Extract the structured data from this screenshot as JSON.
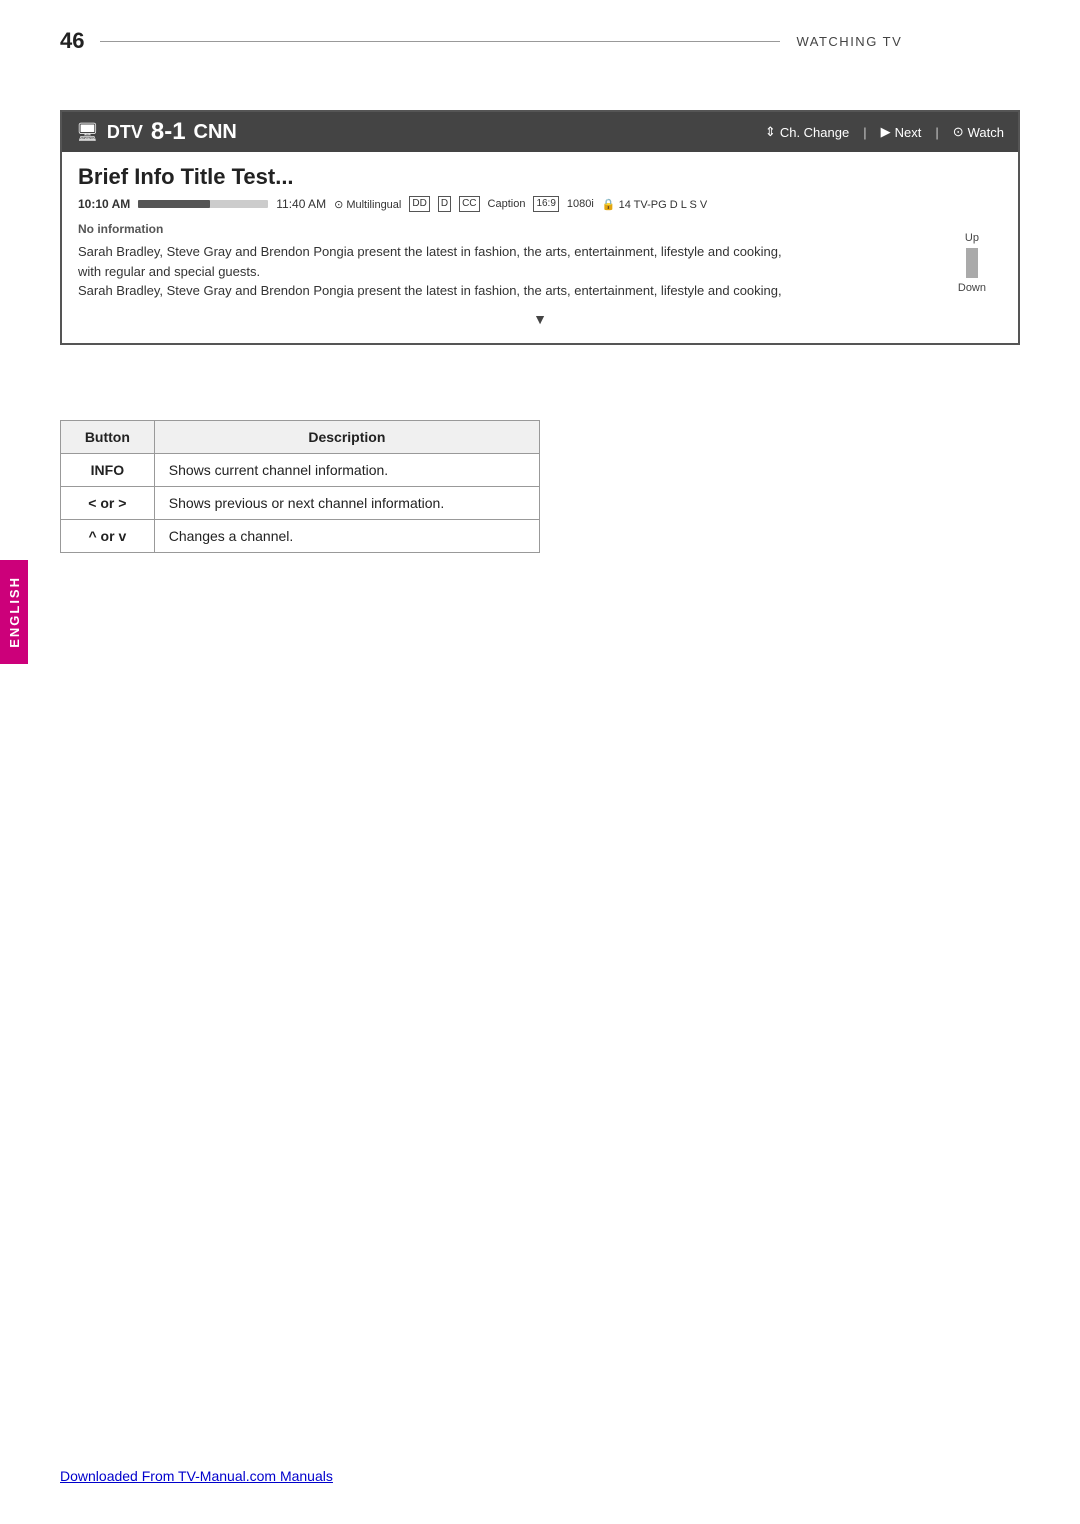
{
  "page": {
    "number": "46",
    "section": "WATCHING TV"
  },
  "tv_panel": {
    "icon": "🖥",
    "prefix": "DTV",
    "channel_number": "8-1",
    "channel_name": "CNN",
    "controls": {
      "ch_change_label": "Ch. Change",
      "next_label": "Next",
      "watch_label": "Watch"
    },
    "program": {
      "title": "Brief Info Title Test...",
      "time_start": "10:10 AM",
      "time_end": "11:40 AM",
      "tags": [
        "Multilingual",
        "DD",
        "D",
        "CC",
        "Caption",
        "16:9",
        "1080i",
        "🔒",
        "14 TV-PG D L S V"
      ],
      "no_info": "No information",
      "description_line1": "Sarah Bradley, Steve Gray and Brendon Pongia present the latest in fashion, the arts, entertainment, lifestyle and cooking,",
      "description_line2": "with regular and special guests.",
      "description_line3": "Sarah Bradley, Steve Gray and Brendon Pongia present the latest in fashion, the arts, entertainment, lifestyle and cooking,",
      "scroll_up": "Up",
      "scroll_down": "Down"
    }
  },
  "table": {
    "headers": [
      "Button",
      "Description"
    ],
    "rows": [
      {
        "button": "INFO",
        "description": "Shows current channel information."
      },
      {
        "button": "< or >",
        "description": "Shows previous or next channel information."
      },
      {
        "button": "^ or v",
        "description": "Changes a channel."
      }
    ]
  },
  "sidebar": {
    "label": "ENGLISH"
  },
  "footer": {
    "link_text": "Downloaded From TV-Manual.com Manuals"
  }
}
